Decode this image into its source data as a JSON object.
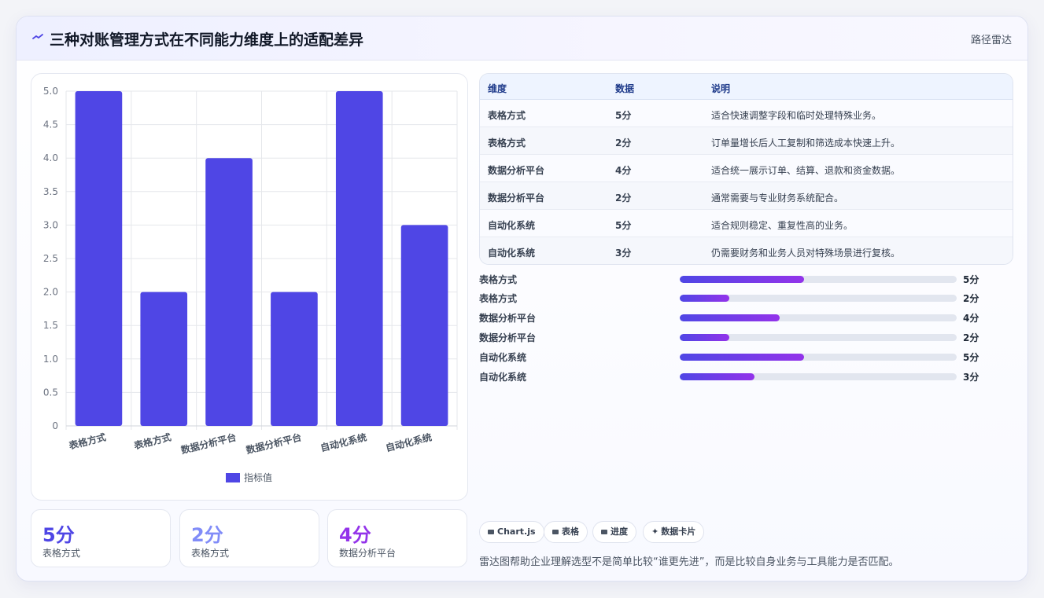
{
  "header": {
    "title": "三种对账管理方式在不同能力维度上的适配差异",
    "tag": "路径雷达"
  },
  "chart_data": {
    "type": "bar",
    "categories": [
      "表格方式",
      "表格方式",
      "数据分析平台",
      "数据分析平台",
      "自动化系统",
      "自动化系统"
    ],
    "series": [
      {
        "name": "指标值",
        "values": [
          5,
          2,
          4,
          2,
          5,
          3
        ]
      }
    ],
    "ylim": [
      0,
      5
    ],
    "yticks": [
      "0",
      "0.5",
      "1.0",
      "1.5",
      "2.0",
      "2.5",
      "3.0",
      "3.5",
      "4.0",
      "4.5",
      "5.0"
    ],
    "legend": "bottom",
    "grid": true,
    "color": "#4f46e5"
  },
  "stats": [
    {
      "value": "5分",
      "label": "表格方式",
      "color": "#4f46e5"
    },
    {
      "value": "2分",
      "label": "表格方式",
      "color": "#818cf8"
    },
    {
      "value": "4分",
      "label": "数据分析平台",
      "color": "#9333ea"
    }
  ],
  "table": {
    "headers": [
      "维度",
      "数据",
      "说明"
    ],
    "rows": [
      [
        "表格方式",
        "5分",
        "适合快速调整字段和临时处理特殊业务。"
      ],
      [
        "表格方式",
        "2分",
        "订单量增长后人工复制和筛选成本快速上升。"
      ],
      [
        "数据分析平台",
        "4分",
        "适合统一展示订单、结算、退款和资金数据。"
      ],
      [
        "数据分析平台",
        "2分",
        "通常需要与专业财务系统配合。"
      ],
      [
        "自动化系统",
        "5分",
        "适合规则稳定、重复性高的业务。"
      ],
      [
        "自动化系统",
        "3分",
        "仍需要财务和业务人员对特殊场景进行复核。"
      ]
    ]
  },
  "progress": [
    {
      "label": "表格方式",
      "value": "5分",
      "fraction": 0.45
    },
    {
      "label": "表格方式",
      "value": "2分",
      "fraction": 0.18
    },
    {
      "label": "数据分析平台",
      "value": "4分",
      "fraction": 0.36
    },
    {
      "label": "数据分析平台",
      "value": "2分",
      "fraction": 0.18
    },
    {
      "label": "自动化系统",
      "value": "5分",
      "fraction": 0.45
    },
    {
      "label": "自动化系统",
      "value": "3分",
      "fraction": 0.27
    }
  ],
  "chips": [
    "Chart.js",
    "表格",
    "进度",
    "数据卡片"
  ],
  "note": "雷达图帮助企业理解选型不是简单比较“谁更先进”，而是比较自身业务与工具能力是否匹配。"
}
